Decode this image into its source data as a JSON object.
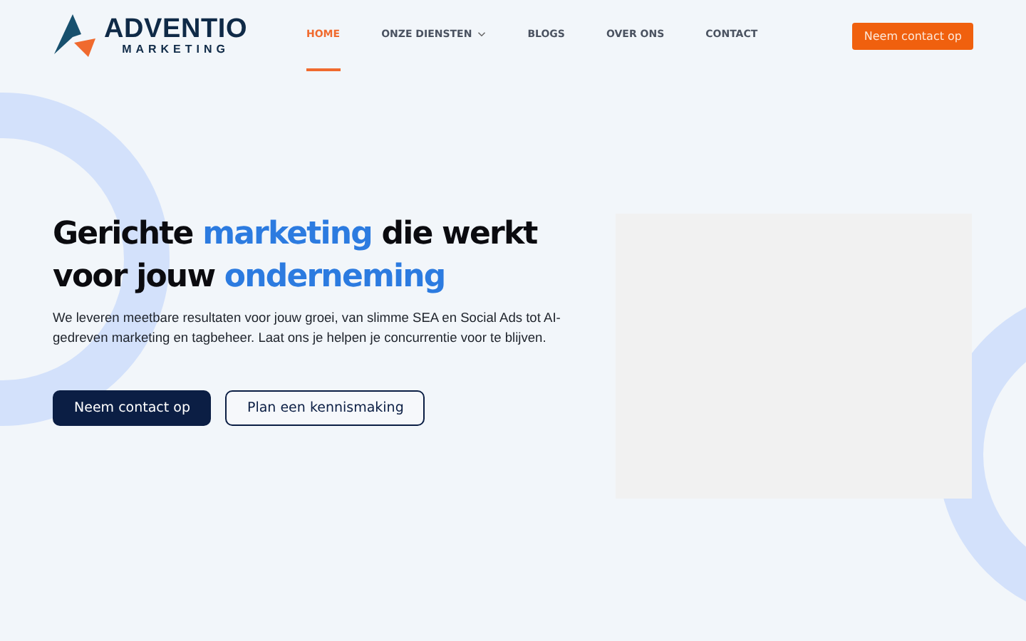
{
  "logo": {
    "name": "ADVENTIO",
    "tagline": "MARKETING"
  },
  "nav": [
    {
      "label": "HOME",
      "selected": true,
      "dropdown": false
    },
    {
      "label": "ONZE DIENSTEN",
      "selected": false,
      "dropdown": true
    },
    {
      "label": "BLOGS",
      "selected": false,
      "dropdown": false
    },
    {
      "label": "OVER ONS",
      "selected": false,
      "dropdown": false
    },
    {
      "label": "CONTACT",
      "selected": false,
      "dropdown": false
    }
  ],
  "header_button": "Neem contact op",
  "hero": {
    "headline": [
      {
        "text": "Gerichte ",
        "highlight": false
      },
      {
        "text": "marketing",
        "highlight": true
      },
      {
        "text": " die werkt voor jouw ",
        "highlight": false
      },
      {
        "text": "onderneming",
        "highlight": true
      }
    ],
    "intro": "We leveren meetbare resultaten voor jouw groei, van slimme SEA en Social Ads tot AI-gedreven marketing en tagbeheer. Laat ons je helpen je concurrentie voor te blijven.",
    "buttons": [
      {
        "label": "Neem contact op",
        "kind": "primary"
      },
      {
        "label": "Plan een kennismaking",
        "kind": "outline"
      }
    ],
    "image": {
      "kind": "placeholder"
    }
  }
}
